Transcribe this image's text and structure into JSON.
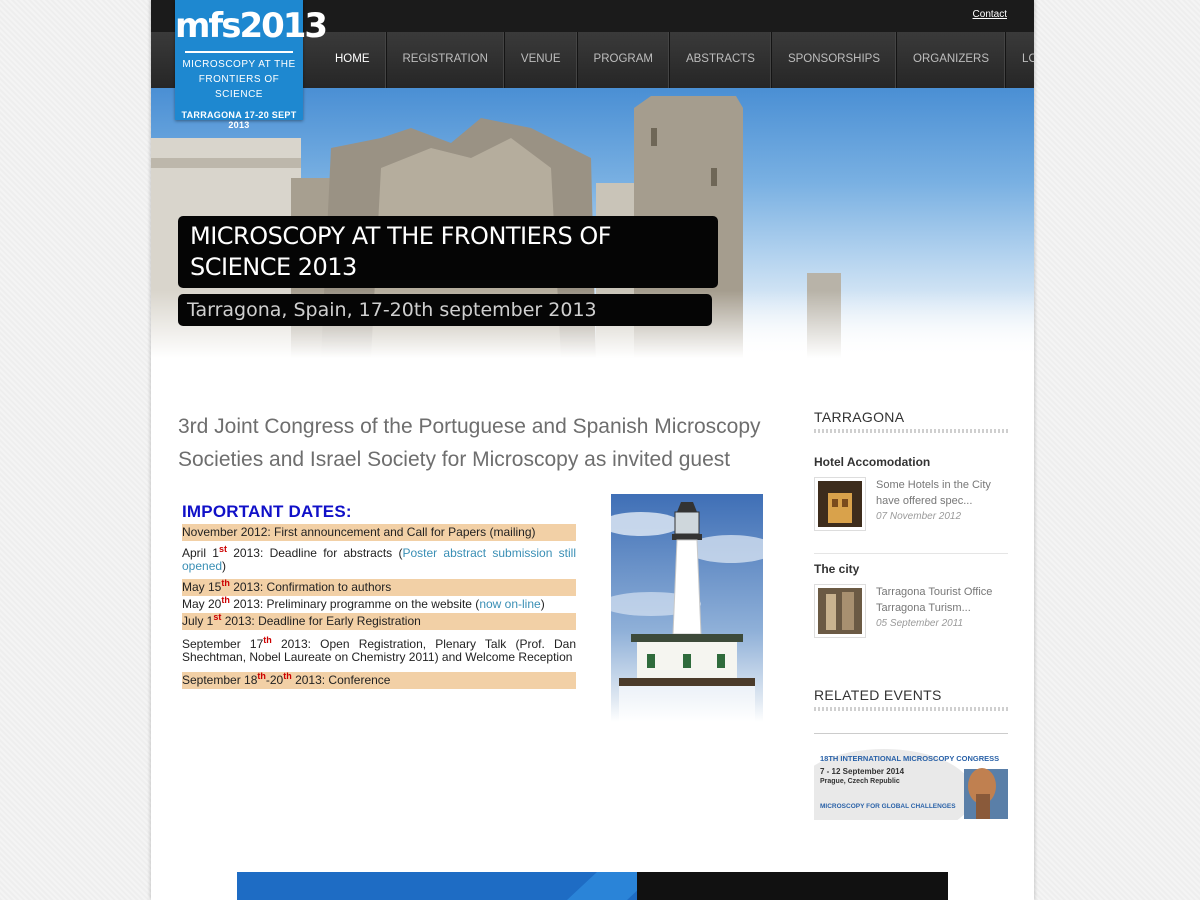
{
  "header": {
    "contact": "Contact",
    "logo": {
      "main": "mfs2013",
      "sub_line1": "MICROSCOPY AT THE",
      "sub_line2": "FRONTIERS OF SCIENCE",
      "date": "TARRAGONA 17-20 SEPT 2013"
    },
    "nav": [
      "HOME",
      "REGISTRATION",
      "VENUE",
      "PROGRAM",
      "ABSTRACTS",
      "SPONSORSHIPS",
      "ORGANIZERS",
      "LOGIN"
    ],
    "active_nav": "HOME"
  },
  "hero": {
    "title": "MICROSCOPY AT THE FRONTIERS OF SCIENCE 2013",
    "subtitle": "Tarragona, Spain, 17-20th september 2013"
  },
  "main": {
    "intro": "3rd Joint Congress of the Portuguese and Spanish Microscopy Societies and Israel Society for Microscopy as invited guest",
    "dates_heading": "IMPORTANT DATES:",
    "dates": [
      {
        "pre": "November 2012: First announcement and Call for Papers (mailing)",
        "sup": "",
        "post": "",
        "link": "",
        "tail": ""
      },
      {
        "pre": "April 1",
        "sup": "st",
        "post": " 2013: Deadline for abstracts (",
        "link": "Poster abstract submission still opened",
        "tail": ")"
      },
      {
        "pre": "May 15",
        "sup": "th",
        "post": " 2013: Confirmation to authors",
        "link": "",
        "tail": ""
      },
      {
        "pre": "May 20",
        "sup": "th",
        "post": " 2013: Preliminary programme on the website (",
        "link": "now on-line",
        "tail": ")"
      },
      {
        "pre": "July 1",
        "sup": "st",
        "post": " 2013: Deadline for Early Registration",
        "link": "",
        "tail": ""
      },
      {
        "pre": "September 17",
        "sup": "th",
        "post": " 2013: Open Registration, Plenary Talk (Prof. Dan Shechtman, Nobel Laureate on Chemistry 2011) and Welcome Reception",
        "link": "",
        "tail": ""
      },
      {
        "pre": "September 18",
        "sup": "th",
        "post": "-20",
        "sup2": "th",
        "post2": " 2013: Conference",
        "link": "",
        "tail": ""
      }
    ]
  },
  "sidebar": {
    "tarragona_heading": "TARRAGONA",
    "posts": [
      {
        "title": "Hotel Accomodation",
        "text": "Some Hotels in the City have offered spec...",
        "date": "07 November 2012"
      },
      {
        "title": "The city",
        "text": "Tarragona Tourist Office Tarragona Turism...",
        "date": "05 September 2011"
      }
    ],
    "related_heading": "RELATED EVENTS",
    "banner": {
      "line1": "18TH INTERNATIONAL MICROSCOPY CONGRESS",
      "line2": "7 - 12 September 2014",
      "line3": "Prague, Czech Republic",
      "line4": "MICROSCOPY FOR GLOBAL CHALLENGES"
    }
  },
  "colors": {
    "logo_blue": "#1e88d0",
    "date_highlight": "#f2d0a6",
    "dates_heading": "#1010c8",
    "link": "#3a8fb5",
    "sup": "#cc0000"
  }
}
